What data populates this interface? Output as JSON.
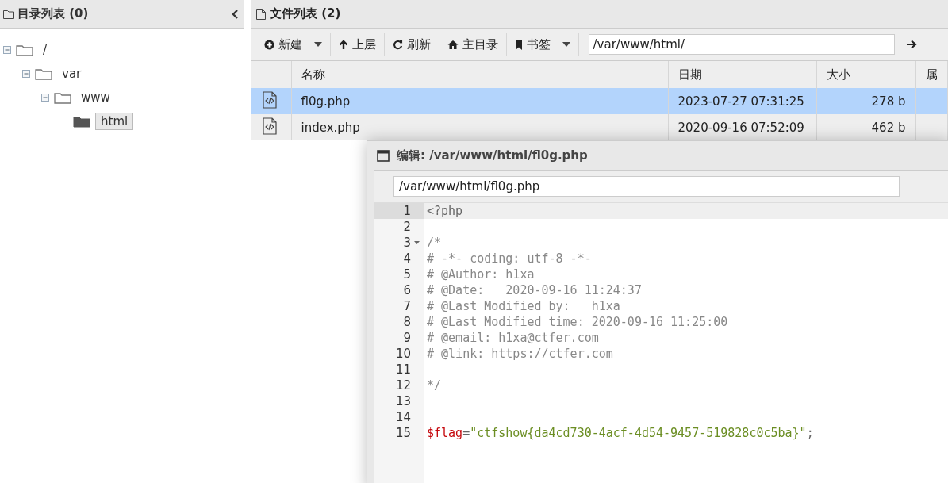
{
  "directory_panel": {
    "title": "目录列表 (0)",
    "tree": [
      {
        "label": "/",
        "expanded": true,
        "selected": false,
        "children": [
          {
            "label": "var",
            "expanded": true,
            "selected": false,
            "children": [
              {
                "label": "www",
                "expanded": true,
                "selected": false,
                "children": [
                  {
                    "label": "html",
                    "selected": true
                  }
                ]
              }
            ]
          }
        ]
      }
    ]
  },
  "file_panel": {
    "title": "文件列表 (2)",
    "toolbar": [
      {
        "label": "新建",
        "dropdown": true
      },
      {
        "label": "上层",
        "dropdown": false
      },
      {
        "label": "刷新",
        "dropdown": false
      },
      {
        "label": "主目录",
        "dropdown": false
      },
      {
        "label": "书签",
        "dropdown": true
      }
    ],
    "path": "/var/www/html/",
    "columns": [
      "名称",
      "日期",
      "大小",
      "属"
    ],
    "rows": [
      {
        "name": "fl0g.php",
        "date": "2023-07-27 07:31:25",
        "size": "278 b",
        "selected": true
      },
      {
        "name": "index.php",
        "date": "2020-09-16 07:52:09",
        "size": "462 b",
        "selected": false
      }
    ]
  },
  "editor": {
    "title": "编辑: /var/www/html/fl0g.php",
    "path": "/var/www/html/fl0g.php",
    "lines": [
      {
        "number": "1",
        "active": true,
        "foldable": false,
        "segments": [
          {
            "kind": "plain",
            "text": "<?php"
          }
        ]
      },
      {
        "number": "2",
        "active": false,
        "foldable": false
      },
      {
        "number": "3",
        "active": false,
        "foldable": true,
        "segments": [
          {
            "kind": "comment",
            "text": "/*"
          }
        ]
      },
      {
        "number": "4",
        "active": false,
        "foldable": false,
        "segments": [
          {
            "kind": "comment",
            "text": "# -*- coding: utf-8 -*-"
          }
        ]
      },
      {
        "number": "5",
        "active": false,
        "foldable": false,
        "segments": [
          {
            "kind": "comment",
            "text": "# @Author: h1xa"
          }
        ]
      },
      {
        "number": "6",
        "active": false,
        "foldable": false,
        "segments": [
          {
            "kind": "comment",
            "text": "# @Date:   2020-09-16 11:24:37"
          }
        ]
      },
      {
        "number": "7",
        "active": false,
        "foldable": false,
        "segments": [
          {
            "kind": "comment",
            "text": "# @Last Modified by:   h1xa"
          }
        ]
      },
      {
        "number": "8",
        "active": false,
        "foldable": false,
        "segments": [
          {
            "kind": "comment",
            "text": "# @Last Modified time: 2020-09-16 11:25:00"
          }
        ]
      },
      {
        "number": "9",
        "active": false,
        "foldable": false,
        "segments": [
          {
            "kind": "comment",
            "text": "# @email: h1xa@ctfer.com"
          }
        ]
      },
      {
        "number": "10",
        "active": false,
        "foldable": false,
        "segments": [
          {
            "kind": "comment",
            "text": "# @link: https://ctfer.com"
          }
        ]
      },
      {
        "number": "11",
        "active": false,
        "foldable": false
      },
      {
        "number": "12",
        "active": false,
        "foldable": false,
        "segments": [
          {
            "kind": "comment",
            "text": "*/"
          }
        ]
      },
      {
        "number": "13",
        "active": false,
        "foldable": false
      },
      {
        "number": "14",
        "active": false,
        "foldable": false
      },
      {
        "number": "15",
        "active": false,
        "foldable": false,
        "segments": [
          {
            "kind": "variable",
            "text": "$flag"
          },
          {
            "kind": "plain",
            "text": "="
          },
          {
            "kind": "string",
            "text": "\"ctfshow{da4cd730-4acf-4d54-9457-519828c0c5ba}\""
          },
          {
            "kind": "plain",
            "text": ";"
          }
        ]
      }
    ]
  }
}
